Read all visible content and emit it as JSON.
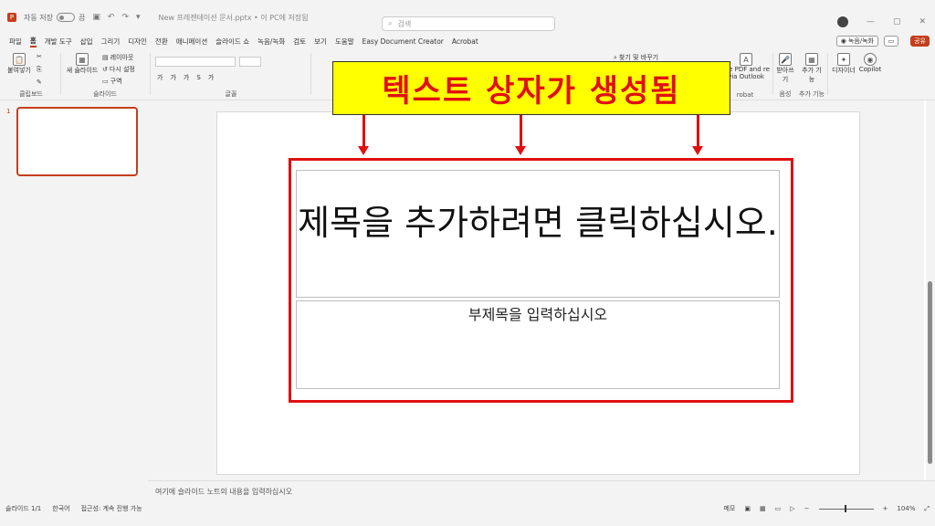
{
  "titlebar": {
    "autosave_label": "자동 저장",
    "autosave_state": "끔",
    "doc_title": "New 프레젠테이션 문서.pptx • 이 PC에 저장됨",
    "search_placeholder": "검색"
  },
  "menu": {
    "tabs": [
      "파일",
      "홈",
      "개발 도구",
      "삽입",
      "그리기",
      "디자인",
      "전환",
      "애니메이션",
      "슬라이드 쇼",
      "녹음/녹화",
      "검토",
      "보기",
      "도움말",
      "Easy Document Creator",
      "Acrobat"
    ],
    "record_label": "녹음/녹화",
    "share_label": "공유"
  },
  "ribbon": {
    "paste_label": "붙여넣기",
    "clipboard_group": "클립보드",
    "new_slide_label": "새 슬라이드",
    "layout_label": "레이아웃",
    "reset_label": "다시 설정",
    "section_label": "구역",
    "slides_group": "슬라이드",
    "font_group": "글꼴",
    "find_replace_label": "찾기 및 바꾸기",
    "adobe_label": "ate PDF and re via Outlook",
    "adobe_group": "robat",
    "dictate_label": "받아쓰기",
    "voice_group": "음성",
    "addins_label": "추가 기능",
    "addins_group": "추가 기능",
    "designer_label": "디자이너",
    "copilot_label": "Copilot"
  },
  "slides": {
    "current_number": "1"
  },
  "slide": {
    "title_placeholder": "제목을 추가하려면 클릭하십시오.",
    "subtitle_placeholder": "부제목을 입력하십시오"
  },
  "annotation": {
    "banner_text": "텍스트 상자가 생성됨"
  },
  "notes": {
    "placeholder": "여기에 슬라이드 노트의 내용을 입력하십시오"
  },
  "status": {
    "slide_info": "슬라이드 1/1",
    "language": "한국어",
    "accessibility": "접근성: 계속 진행 가능",
    "notes_button": "메모",
    "zoom": "104%"
  }
}
